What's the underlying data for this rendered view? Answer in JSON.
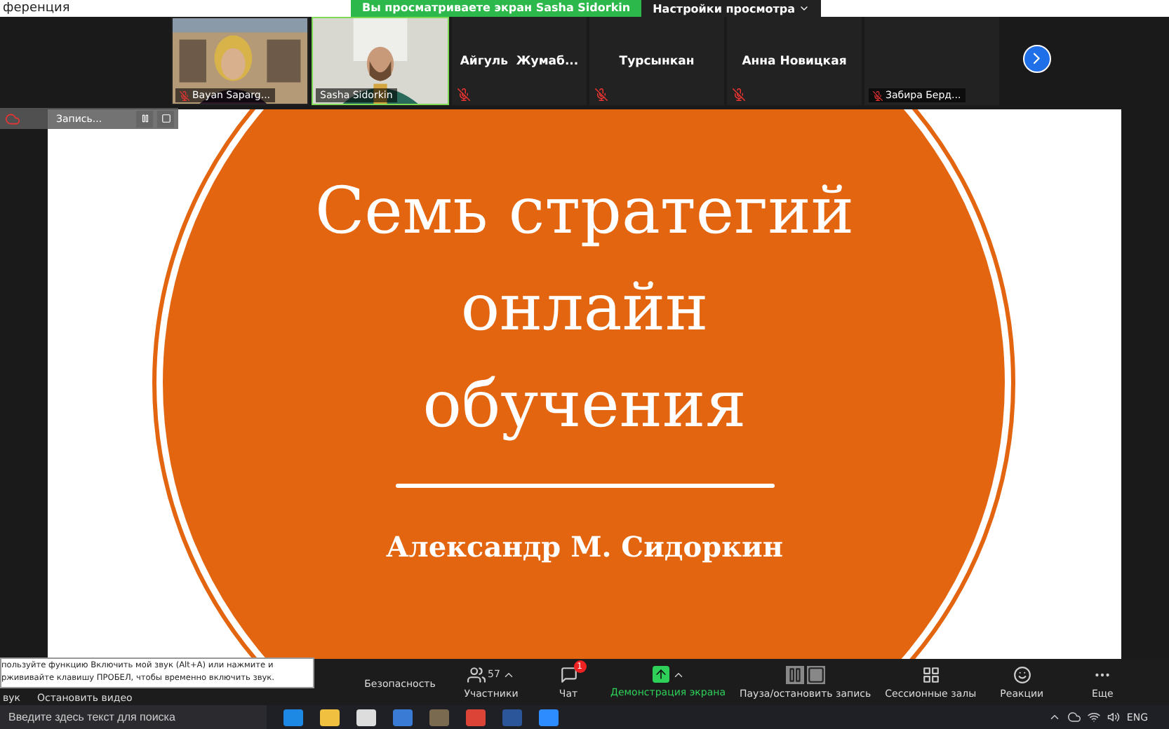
{
  "window": {
    "title": "ференция"
  },
  "share_banner": {
    "text": "Вы просматриваете экран Sasha Sidorkin",
    "settings": "Настройки просмотра"
  },
  "participants": [
    {
      "kind": "video",
      "name": "Bayan Saparg...",
      "muted": true,
      "speaking": false
    },
    {
      "kind": "video",
      "name": "Sasha Sidorkin",
      "muted": false,
      "speaking": true
    },
    {
      "kind": "name",
      "name": "Айгуль  Жумаб...",
      "muted": true,
      "speaking": false
    },
    {
      "kind": "name",
      "name": "Турсынкан",
      "muted": true,
      "speaking": false
    },
    {
      "kind": "name",
      "name": "Анна Новицкая",
      "muted": true,
      "speaking": false
    },
    {
      "kind": "name",
      "name": "Забира Берд...",
      "muted": true,
      "speaking": false
    }
  ],
  "recording": {
    "label": "Запись..."
  },
  "slide": {
    "title_lines": [
      "Семь стратегий",
      "онлайн",
      "обучения"
    ],
    "author": "Александр М. Сидоркин"
  },
  "tooltip": "пользуйте функцию Включить мой звук (Alt+A) или нажмите и\nржививайте клавишу ПРОБЕЛ, чтобы временно включить звук.",
  "toolbar": {
    "left": [
      {
        "label": "вук"
      },
      {
        "label": "Остановить видео"
      }
    ],
    "items": [
      {
        "kind": "security",
        "label": "Безопасность"
      },
      {
        "kind": "participants",
        "label": "Участники",
        "count": "57"
      },
      {
        "kind": "chat",
        "label": "Чат",
        "badge": "1"
      },
      {
        "kind": "share",
        "label": "Демонстрация экрана"
      },
      {
        "kind": "record",
        "label": "Пауза/остановить запись"
      },
      {
        "kind": "rooms",
        "label": "Сессионные залы"
      },
      {
        "kind": "reactions",
        "label": "Реакции"
      },
      {
        "kind": "more",
        "label": "Еще"
      }
    ]
  },
  "taskbar": {
    "search_placeholder": "Введите здесь текст для поиска",
    "language": "ENG"
  }
}
